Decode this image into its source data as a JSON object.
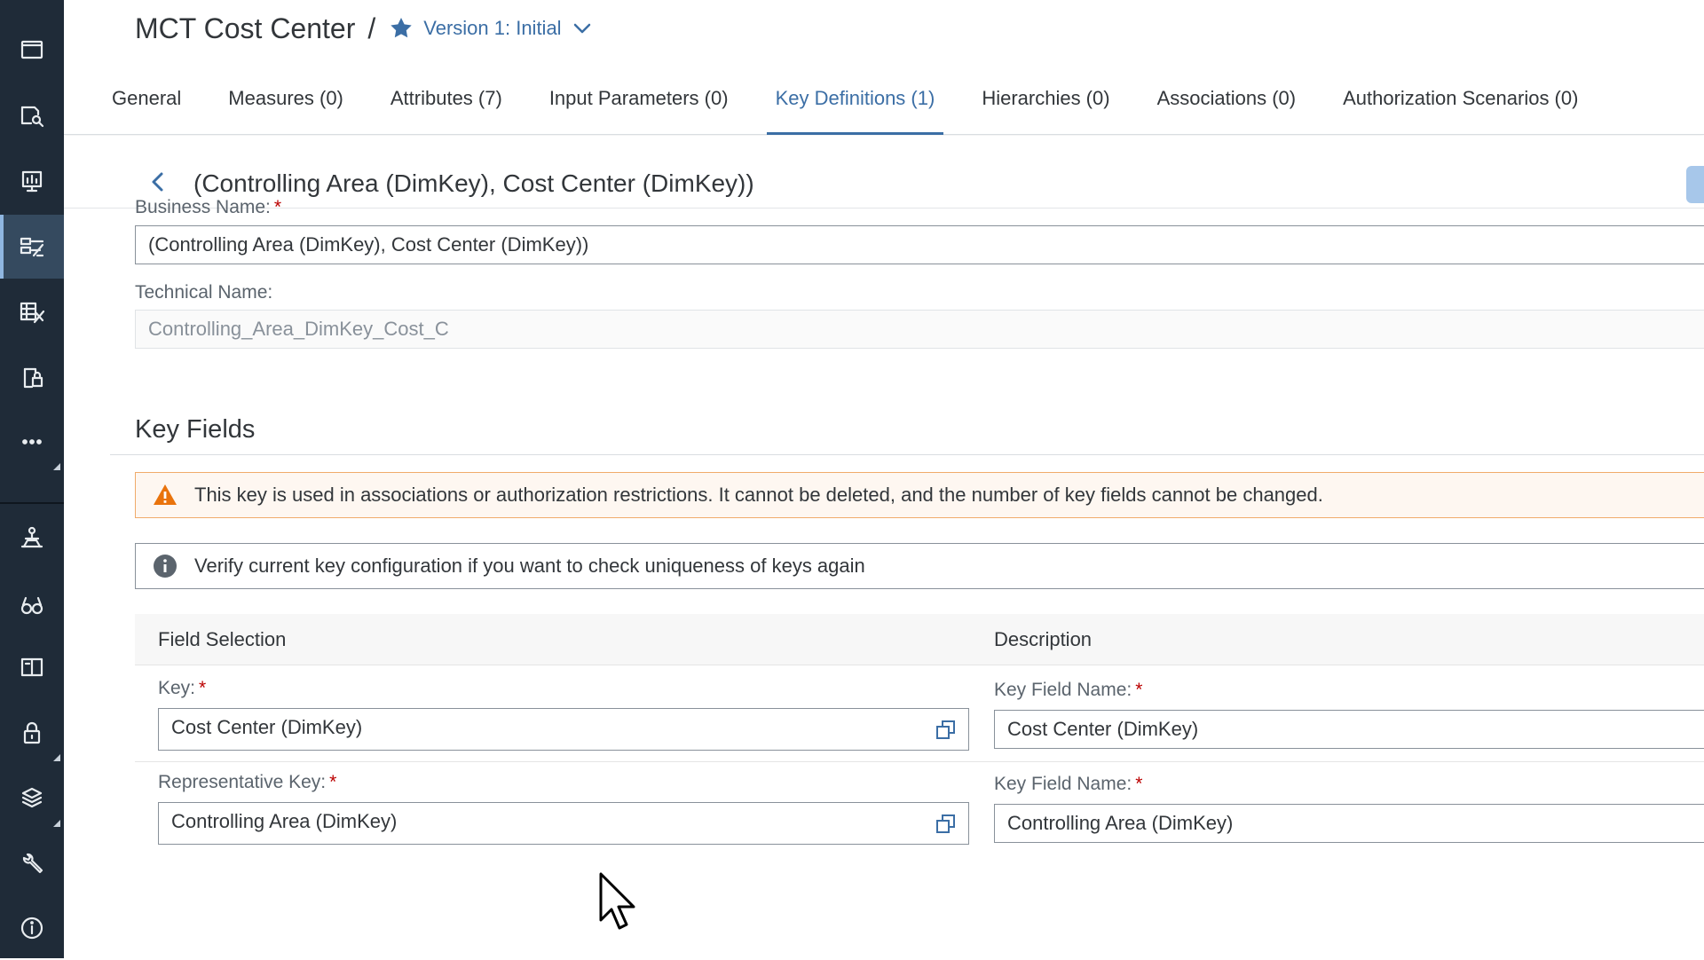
{
  "header": {
    "app_title": "MCT Cost Center",
    "separator": "/",
    "version_label": "Version 1: Initial"
  },
  "tabs": [
    {
      "label": "General",
      "active": false
    },
    {
      "label": "Measures (0)",
      "active": false
    },
    {
      "label": "Attributes (7)",
      "active": false
    },
    {
      "label": "Input Parameters (0)",
      "active": false
    },
    {
      "label": "Key Definitions (1)",
      "active": true
    },
    {
      "label": "Hierarchies (0)",
      "active": false
    },
    {
      "label": "Associations (0)",
      "active": false
    },
    {
      "label": "Authorization Scenarios (0)",
      "active": false
    }
  ],
  "subheader": {
    "title": "(Controlling Area (DimKey), Cost Center (DimKey))"
  },
  "form": {
    "business_name_label": "Business Name:",
    "business_name_required": "*",
    "business_name_value": "(Controlling Area (DimKey), Cost Center (DimKey))",
    "technical_name_label": "Technical Name:",
    "technical_name_value": "Controlling_Area_DimKey_Cost_C"
  },
  "key_fields": {
    "section_title": "Key Fields",
    "warning_message": "This key is used in associations or authorization restrictions. It cannot be deleted, and the number of key fields cannot be changed.",
    "info_message": "Verify current key configuration if you want to check uniqueness of keys again",
    "columns": {
      "field_selection": "Field Selection",
      "description": "Description"
    },
    "rows": [
      {
        "key_label": "Key:",
        "key_value": "Cost Center (DimKey)",
        "desc_label": "Key Field Name:",
        "desc_value": "Cost Center (DimKey)",
        "required": "*"
      },
      {
        "key_label": "Representative Key:",
        "key_value": "Controlling Area (DimKey)",
        "desc_label": "Key Field Name:",
        "desc_value": "Controlling Area (DimKey)",
        "required": "*"
      }
    ]
  },
  "sidebar": {
    "items": [
      {
        "icon": "folder-icon"
      },
      {
        "icon": "repository-search-icon"
      },
      {
        "icon": "presentation-icon"
      },
      {
        "icon": "data-builder-icon"
      },
      {
        "icon": "business-builder-icon"
      },
      {
        "icon": "data-access-icon"
      },
      {
        "icon": "more-icon"
      },
      {
        "icon": "data-integration-icon"
      },
      {
        "icon": "glasses-icon"
      },
      {
        "icon": "catalog-icon"
      },
      {
        "icon": "lock-icon"
      },
      {
        "icon": "packages-icon"
      },
      {
        "icon": "wrench-icon"
      },
      {
        "icon": "info-icon"
      }
    ]
  },
  "colors": {
    "rail": "#1f2b38",
    "accent": "#3b6ea5",
    "warning": "#e9730c",
    "required": "#bb0000"
  }
}
